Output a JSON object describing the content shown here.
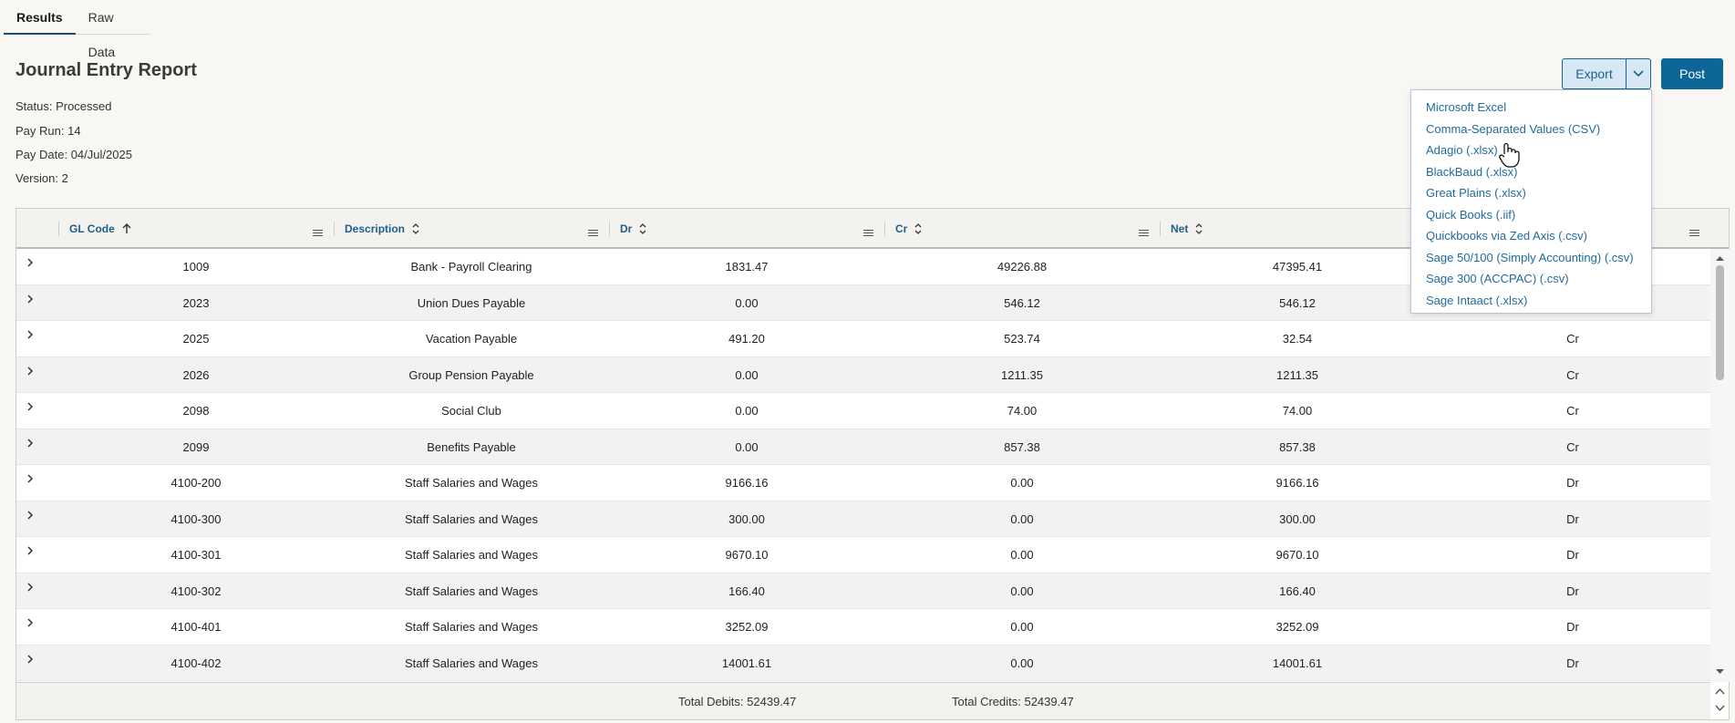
{
  "tabs": [
    {
      "label": "Results"
    },
    {
      "label": "Raw Data"
    }
  ],
  "report": {
    "title": "Journal Entry Report",
    "status": "Status: Processed",
    "pay_run": "Pay Run: 14",
    "pay_date": "Pay Date: 04/Jul/2025",
    "version": "Version: 2"
  },
  "toolbar": {
    "export_label": "Export",
    "post_label": "Post"
  },
  "export_menu": {
    "items": [
      "Microsoft Excel",
      "Comma-Separated Values (CSV)",
      "Adagio (.xlsx)",
      "BlackBaud (.xlsx)",
      "Great Plains (.xlsx)",
      "Quick Books (.iif)",
      "Quickbooks via Zed Axis (.csv)",
      "Sage 50/100 (Simply Accounting) (.csv)",
      "Sage 300 (ACCPAC) (.csv)",
      "Sage Intaact (.xlsx)"
    ]
  },
  "grid": {
    "columns": [
      "GL Code",
      "Description",
      "Dr",
      "Cr",
      "Net"
    ],
    "sort": {
      "column": "GL Code",
      "direction": "ascending"
    },
    "rows": [
      {
        "gl": "1009",
        "desc": "Bank - Payroll Clearing",
        "dr": "1831.47",
        "cr": "49226.88",
        "net": "47395.41",
        "type": ""
      },
      {
        "gl": "2023",
        "desc": "Union Dues Payable",
        "dr": "0.00",
        "cr": "546.12",
        "net": "546.12",
        "type": ""
      },
      {
        "gl": "2025",
        "desc": "Vacation Payable",
        "dr": "491.20",
        "cr": "523.74",
        "net": "32.54",
        "type": "Cr"
      },
      {
        "gl": "2026",
        "desc": "Group Pension Payable",
        "dr": "0.00",
        "cr": "1211.35",
        "net": "1211.35",
        "type": "Cr"
      },
      {
        "gl": "2098",
        "desc": "Social Club",
        "dr": "0.00",
        "cr": "74.00",
        "net": "74.00",
        "type": "Cr"
      },
      {
        "gl": "2099",
        "desc": "Benefits Payable",
        "dr": "0.00",
        "cr": "857.38",
        "net": "857.38",
        "type": "Cr"
      },
      {
        "gl": "4100-200",
        "desc": "Staff Salaries and Wages",
        "dr": "9166.16",
        "cr": "0.00",
        "net": "9166.16",
        "type": "Dr"
      },
      {
        "gl": "4100-300",
        "desc": "Staff Salaries and Wages",
        "dr": "300.00",
        "cr": "0.00",
        "net": "300.00",
        "type": "Dr"
      },
      {
        "gl": "4100-301",
        "desc": "Staff Salaries and Wages",
        "dr": "9670.10",
        "cr": "0.00",
        "net": "9670.10",
        "type": "Dr"
      },
      {
        "gl": "4100-302",
        "desc": "Staff Salaries and Wages",
        "dr": "166.40",
        "cr": "0.00",
        "net": "166.40",
        "type": "Dr"
      },
      {
        "gl": "4100-401",
        "desc": "Staff Salaries and Wages",
        "dr": "3252.09",
        "cr": "0.00",
        "net": "3252.09",
        "type": "Dr"
      },
      {
        "gl": "4100-402",
        "desc": "Staff Salaries and Wages",
        "dr": "14001.61",
        "cr": "0.00",
        "net": "14001.61",
        "type": "Dr"
      }
    ]
  },
  "footer": {
    "total_debits": "Total Debits: 52439.47",
    "total_credits": "Total Credits: 52439.47"
  }
}
